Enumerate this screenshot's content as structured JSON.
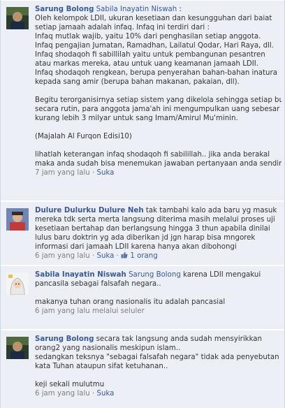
{
  "comments": [
    {
      "author": "Sarung Bolong",
      "mention": "Sabila Inayatin Niswah",
      "after_mention": " :",
      "lines": [
        "Oleh kelompok LDII, ukuran kesetiaan dan kesungguhan dari baiat",
        "setiap jamaah adalah infaq. Infaq ini terdiri dari :",
        "Infaq mutlak wajib, yaitu 10% dari penghasilan setiap anggota.",
        "Infaq pengajian Jumatan, Ramadhan, Lailatul Qodar, Hari Raya, dll.",
        "Infaq shodaqoh fi sabillilah yaitu untuk pembangunan pesantren",
        "atau markas mereka, atau untuk uang keamanan jamaah LDII.",
        "Infaq shodaqoh rengkean, berupa penyerahan bahan-bahan inatura",
        "kepada sang amir (berupa bahan makanan, pakaian, dll).",
        "",
        "Begitu terorganisirnya setiap sistem yang dikelola sehingga setiap bulannya",
        "secara rutin, para anggota jama'ah ini mengumpulkan uang sebesar",
        "kurang lebih 3 milyar untuk sang Imam/Amirul Mu'minin.",
        "",
        "(Majalah Al Furqon Edisi10)",
        "",
        "lihatlah keterangan infaq shodaqoh fi sabilillah.. jika anda berakal",
        "maka anda sudah bisa menemukan jawaban pertanyaan anda sendiri"
      ],
      "time": "7 jam yang lalu",
      "like": "Suka"
    },
    {
      "author": "Dulure Dulurku Dulure Neh",
      "mention": "",
      "after_mention": "",
      "first_line": " tak tambahi kalo ada baru yg masuk",
      "lines": [
        "mereka tdk serta merta langsung diterima masih melalui proses uji",
        "kesetiaan bertahap dan berlangsung hingga 3 thun apabila dinilai",
        "lulus baru doktrin yg ada diberikan jd jgn harap bisa mngorek",
        "informasi dari jamaah LDII karena hanya akan dibohongi"
      ],
      "time": "6 jam yang lalu",
      "like": "Suka",
      "like_count": "1 orang"
    },
    {
      "author": "Sabila Inayatin Niswah",
      "mention": "Sarung Bolong",
      "after_mention": " karena LDII mengakui",
      "lines": [
        "pancasila sebagai falsafah negara..",
        "",
        "makanya tuhan orang nasionalis itu adalah pancasial"
      ],
      "time": "6 jam yang lalu melalui seluler",
      "like": "Suka"
    },
    {
      "author": "Sarung Bolong",
      "mention": "",
      "after_mention": "",
      "first_line": " secara tak langsung anda sudah mensyirikkan",
      "lines": [
        "orang2 yang nasionalis meskipun islam..",
        "sedangkan teksnya \"sebagai falsafah negara\" tidak ada penyebutan",
        "kata Tuhan ataupun sifat ketuhanan..",
        "",
        "keji sekali mulutmu"
      ],
      "time": "6 jam yang lalu",
      "like": "Suka"
    }
  ],
  "separator": "·",
  "colors": {
    "link": "#3b5998",
    "background": "#eceff5",
    "meta": "#808080"
  }
}
